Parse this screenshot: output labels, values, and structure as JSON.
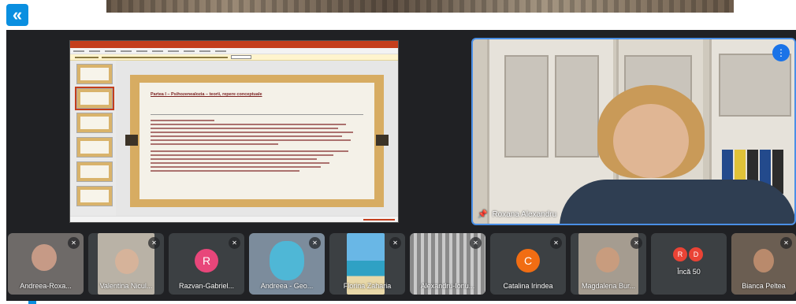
{
  "colors": {
    "meet_bg": "#202124",
    "tile_bg": "#3c4043",
    "accent": "#1a73e8",
    "ppt_red": "#c43e1c",
    "site_blue": "#0a8fe0"
  },
  "page": {
    "collapse_icon": "double-chevron-left-icon",
    "collapse_glyph": "«"
  },
  "presentation": {
    "slide_heading": "Partea I – Psihozenealozia – teorii, repere conceptuale"
  },
  "speaker": {
    "name": "Roxana Alexandru",
    "pin_icon": "pin-icon",
    "more_icon": "more-vertical-icon"
  },
  "participants": [
    {
      "name": "Andreea-Roxa...",
      "type": "video",
      "muted": true
    },
    {
      "name": "Valentina Nicul...",
      "type": "video",
      "muted": true
    },
    {
      "name": "Razvan-Gabriel...",
      "type": "avatar",
      "initial": "R",
      "avatar_color": "#e8467a",
      "muted": true
    },
    {
      "name": "Andreea - Geo...",
      "type": "video",
      "muted": true
    },
    {
      "name": "Florina Zaharia",
      "type": "video",
      "muted": true
    },
    {
      "name": "Alexandru-Ionu...",
      "type": "video",
      "muted": true
    },
    {
      "name": "Catalina Irindea",
      "type": "avatar",
      "initial": "C",
      "avatar_color": "#f16d13",
      "muted": true
    },
    {
      "name": "Magdalena Bur...",
      "type": "video",
      "muted": true
    },
    {
      "name": "Încă 50",
      "type": "group",
      "initials": [
        "R",
        "D"
      ],
      "avatar_colors": [
        "#ea4335",
        "#ea4335"
      ],
      "muted": false
    },
    {
      "name": "Bianca Peltea",
      "type": "video",
      "muted": true
    }
  ]
}
